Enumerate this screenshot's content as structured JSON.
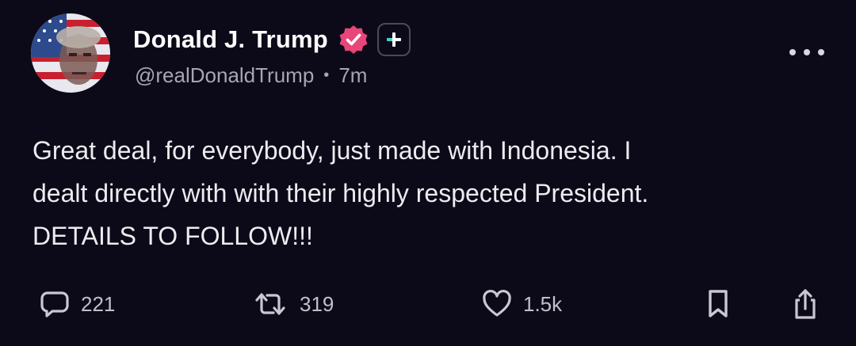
{
  "author": {
    "display_name": "Donald J. Trump",
    "handle": "@realDonaldTrump",
    "separator": "•",
    "timestamp": "7m"
  },
  "post": {
    "lines": [
      "Great deal, for everybody, just made with Indonesia. I",
      "dealt directly with with their highly respected President.",
      "DETAILS TO FOLLOW!!!"
    ]
  },
  "actions": {
    "reply_count": "221",
    "repost_count": "319",
    "like_count": "1.5k"
  },
  "icons": {
    "verified": "verified-badge-icon",
    "plus": "plus-icon",
    "more": "more-horizontal-icon",
    "reply": "comment-icon",
    "repost": "repost-icon",
    "like": "heart-icon",
    "bookmark": "bookmark-icon",
    "share": "share-icon"
  },
  "colors": {
    "background": "#0c0a18",
    "verified_badge": "#e8457a",
    "muted_text": "#a6a6b2"
  }
}
